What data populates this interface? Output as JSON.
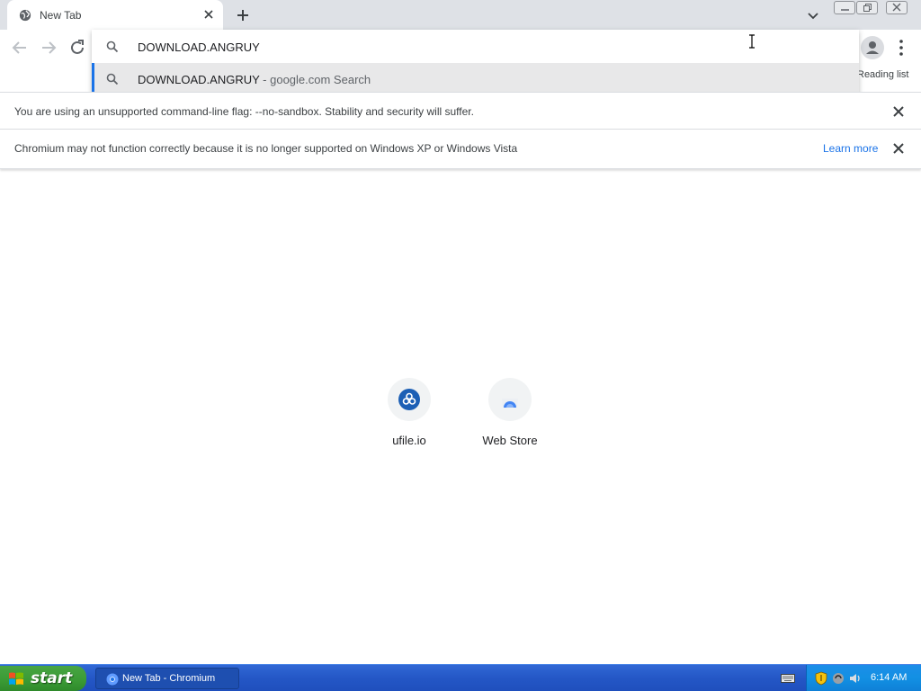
{
  "colors": {
    "accent": "#1a73e8",
    "tabstrip": "#dee1e6",
    "taskbar": "#2457c6",
    "start_green": "#3a9a35",
    "tray": "#1290e3"
  },
  "tab": {
    "title": "New Tab",
    "favicon": "globe-icon"
  },
  "toolbar": {
    "reading_list_label": "Reading list"
  },
  "omnibox": {
    "input_value": "DOWNLOAD.ANGRUY",
    "suggestions": [
      {
        "query": "DOWNLOAD.ANGRUY",
        "description": " - google.com Search",
        "icon": "search-icon"
      }
    ]
  },
  "infobars": [
    {
      "message": "You are using an unsupported command-line flag: --no-sandbox. Stability and security will suffer."
    },
    {
      "message": "Chromium may not function correctly because it is no longer supported on Windows XP or Windows Vista",
      "link": "Learn more"
    }
  ],
  "shortcuts": [
    {
      "label": "ufile.io",
      "icon": "ufile-icon"
    },
    {
      "label": "Web Store",
      "icon": "web-store-icon"
    }
  ],
  "taskbar": {
    "start_label": "start",
    "task_label": "New Tab - Chromium",
    "clock": "6:14 AM"
  }
}
